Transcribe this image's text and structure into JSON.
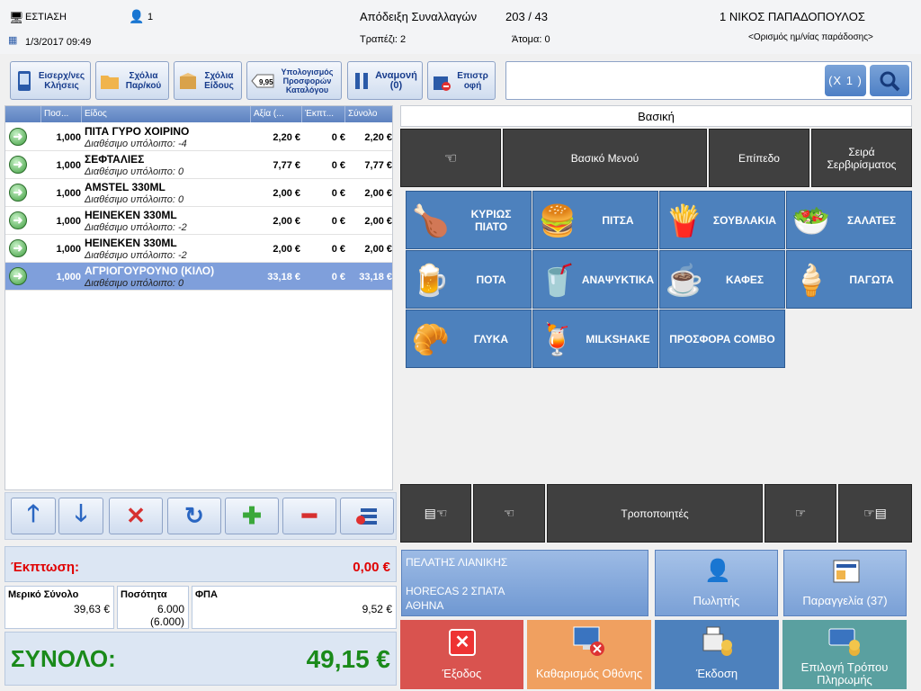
{
  "header": {
    "station": "ΕΣΤΙΑΣΗ",
    "user_count": "1",
    "datetime": "1/3/2017 09:49",
    "receipt_title": "Απόδειξη Συναλλαγών",
    "receipt_number": "203 / 43",
    "table_label": "Τραπέζι: 2",
    "persons_label": "Άτομα: 0",
    "customer": "1 ΝΙΚΟΣ ΠΑΠΑΔΟΠΟΥΛΟΣ",
    "delivery_link": "<Ορισμός ημ/νίας παράδοσης>"
  },
  "toolbar": {
    "incoming_calls": "Εισερχ/νες Κλήσεις",
    "order_comments": "Σχόλια Παρ/κού",
    "item_comments": "Σχόλια Είδους",
    "calc_offers": "Υπολογισμός Προσφορών Καταλόγου",
    "calc_price": "9,95",
    "hold": "Αναμονή (0)",
    "return": "Επιστρ οφή",
    "multiplier": "(X 1 )"
  },
  "grid": {
    "columns": [
      "Ποσ...",
      "Είδος",
      "Αξία (...",
      "Έκπτ...",
      "Σύνολο"
    ],
    "rows": [
      {
        "qty": "1,000",
        "name": "ΠΙΤΑ ΓΥΡΟ ΧΟΙΡΙΝΟ",
        "avail": "Διαθέσιμο υπόλοιπο: -4",
        "value": "2,20 €",
        "disc": "0 €",
        "total": "2,20 €"
      },
      {
        "qty": "1,000",
        "name": "ΣΕΦΤΑΛΙΕΣ",
        "avail": "Διαθέσιμο υπόλοιπο: 0",
        "value": "7,77 €",
        "disc": "0 €",
        "total": "7,77 €"
      },
      {
        "qty": "1,000",
        "name": "AMSTEL 330ML",
        "avail": "Διαθέσιμο υπόλοιπο: 0",
        "value": "2,00 €",
        "disc": "0 €",
        "total": "2,00 €"
      },
      {
        "qty": "1,000",
        "name": "HEINEKEN 330ML",
        "avail": "Διαθέσιμο υπόλοιπο: -2",
        "value": "2,00 €",
        "disc": "0 €",
        "total": "2,00 €"
      },
      {
        "qty": "1,000",
        "name": "HEINEKEN 330ML",
        "avail": "Διαθέσιμο υπόλοιπο: -2",
        "value": "2,00 €",
        "disc": "0 €",
        "total": "2,00 €"
      },
      {
        "qty": "1,000",
        "name": "ΑΓΡΙΟΓΟΥΡΟΥΝΟ (ΚΙΛΟ)",
        "avail": "Διαθέσιμο υπόλοιπο: 0",
        "value": "33,18 €",
        "disc": "0 €",
        "total": "33,18 €"
      }
    ]
  },
  "totals": {
    "discount_label": "Έκπτωση:",
    "discount_value": "0,00 €",
    "subtotal_label": "Μερικό Σύνολο",
    "subtotal_value": "39,63 €",
    "quantity_label": "Ποσότητα",
    "quantity_value": "6.000",
    "quantity_sub": "(6.000)",
    "vat_label": "ΦΠΑ",
    "vat_value": "9,52 €",
    "total_label": "ΣΥΝΟΛΟ:",
    "total_value": "49,15 €"
  },
  "categories": {
    "header": "Βασική",
    "top_nav": {
      "back": "☜",
      "main_menu": "Βασικό Μενού",
      "level": "Επίπεδο",
      "serving_order": "Σειρά Σερβιρίσματος"
    },
    "items": [
      {
        "label": "ΚΥΡΙΩΣ ΠΙΑΤΟ",
        "icon": "🍗"
      },
      {
        "label": "ΠΙΤΣΑ",
        "icon": "🍔"
      },
      {
        "label": "ΣΟΥΒΛΑΚΙΑ",
        "icon": "🍟"
      },
      {
        "label": "ΣΑΛΑΤΕΣ",
        "icon": "🥗"
      },
      {
        "label": "ΠΟΤΑ",
        "icon": "🍺"
      },
      {
        "label": "ΑΝΑΨΥΚΤΙΚΑ",
        "icon": "🥤"
      },
      {
        "label": "ΚΑΦΕΣ",
        "icon": "☕"
      },
      {
        "label": "ΠΑΓΩΤΑ",
        "icon": "🍦"
      },
      {
        "label": "ΓΛΥΚΑ",
        "icon": "🥐"
      },
      {
        "label": "MILKSHAKE",
        "icon": "🍹"
      },
      {
        "label": "ΠΡΟΣΦΟΡΑ COMBO",
        "icon": ""
      }
    ],
    "bottom_nav": {
      "first": "▤☜",
      "prev": "☜",
      "modifiers": "Τροποποιητές",
      "next": "☞",
      "last": "☞▤"
    }
  },
  "customer_panel": {
    "line1": "ΠΕΛΑΤΗΣ ΛΙΑΝΙΚΗΣ",
    "line2": "HORECAS 2 ΣΠΑΤΑ",
    "line3": "ΑΘΗΝΑ"
  },
  "actions": {
    "seller": "Πωλητής",
    "orders": "Παραγγελία (37)",
    "exit": "Έξοδος",
    "clear_screen": "Καθαρισμός Οθόνης",
    "issue": "Έκδοση",
    "payment": "Επιλογή Τρόπου Πληρωμής"
  },
  "colors": {
    "exit": "#d9534f",
    "clear": "#f0a060",
    "issue": "#4d81bd",
    "payment": "#5aa0a0",
    "total_green": "#1a8a1a",
    "discount_red": "#e00000"
  }
}
